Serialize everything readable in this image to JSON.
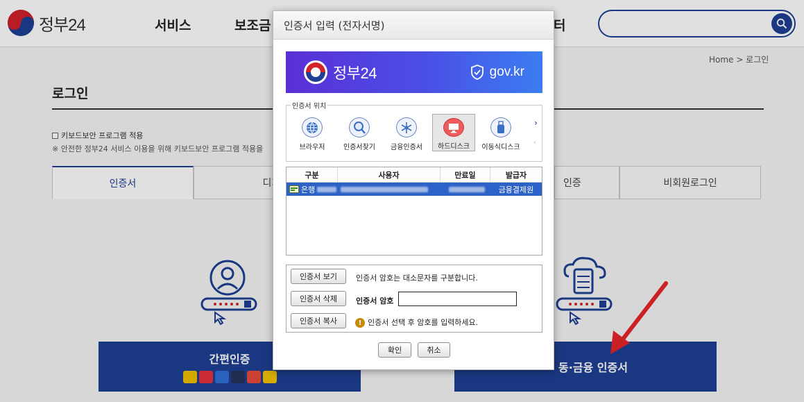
{
  "site": {
    "logo_text": "정부24"
  },
  "gnb": {
    "items": [
      "서비스",
      "보조금",
      "터"
    ]
  },
  "breadcrumb": {
    "home": "Home",
    "sep": ">",
    "current": "로그인"
  },
  "page": {
    "title": "로그인",
    "keyboard_security_label": "키보드보안 프로그램 적용",
    "keyboard_security_note": "※ 안전한 정부24 서비스 이용을 위해 키보드보안 프로그램 적용을"
  },
  "tabs": [
    "인증서",
    "디지털원",
    "인증",
    "비회원로그인"
  ],
  "auth_cards": {
    "simple": "간편인증",
    "joint": "동·금융 인증서"
  },
  "dialog": {
    "title": "인증서 입력 (전자서명)",
    "banner_brand": "정부24",
    "banner_gov": "gov.kr",
    "location_legend": "인증서 위치",
    "locations": [
      "브라우저",
      "인증서찾기",
      "금융인증서",
      "하드디스크",
      "이동식디스크"
    ],
    "selected_location": "하드디스크",
    "table": {
      "headers": [
        "구분",
        "사용자",
        "만료일",
        "발급자"
      ],
      "rows": [
        {
          "type": "은행",
          "user": "",
          "expiry": "",
          "issuer": "금융결제원"
        }
      ]
    },
    "buttons": {
      "view": "인증서 보기",
      "delete": "인증서 삭제",
      "copy": "인증서 복사",
      "ok": "확인",
      "cancel": "취소"
    },
    "case_note": "인증서 암호는 대소문자를 구분합니다.",
    "password_label": "인증서 암호",
    "password_value": "",
    "warning": "인증서 선택 후 암호를 입력하세요."
  },
  "colors": {
    "brand_blue": "#1e3f93",
    "brand_red": "#d3222a",
    "selection_blue": "#2c62c7",
    "arrow_red": "#e8262a"
  }
}
